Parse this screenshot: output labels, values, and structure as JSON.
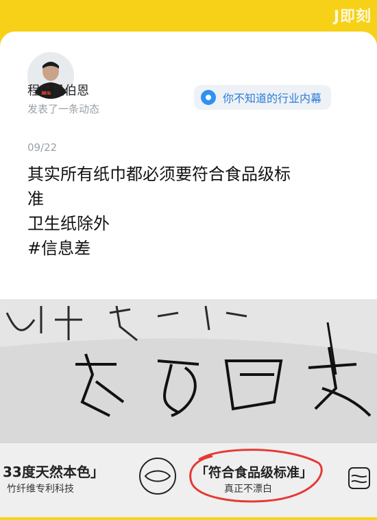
{
  "app": {
    "watermark": "J即刻",
    "brand_color": "#F6D117"
  },
  "post": {
    "author_name": "程序员伯恩",
    "action_text": "发表了一条动态",
    "topic_label": "你不知道的行业内幕",
    "date": "09/22",
    "lines": [
      "其实所有纸巾都必须要符合食品级标",
      "准",
      "卫生纸除外",
      "#信息差"
    ]
  },
  "image": {
    "handwriting_text": "亲密更安",
    "product_left_title": "33度天然本色」",
    "product_left_subtitle": "竹纤维专利科技",
    "product_mid_title": "「符合食品级标准」",
    "product_mid_subtitle": "真正不漂白",
    "highlight_color": "#E53935"
  }
}
